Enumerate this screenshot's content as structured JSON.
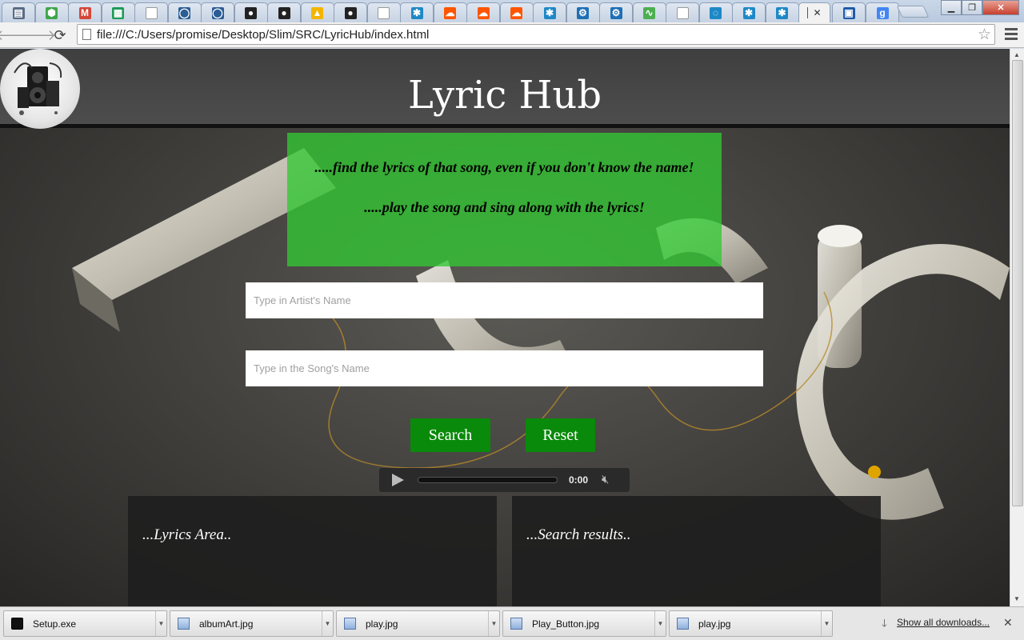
{
  "browser": {
    "tabs": [
      {
        "icon": "doc-icon",
        "color": "#5a6b84"
      },
      {
        "icon": "shield-icon",
        "color": "#3fa64a"
      },
      {
        "icon": "gmail-icon",
        "color": "#d44638"
      },
      {
        "icon": "sheets-icon",
        "color": "#1e9b56"
      },
      {
        "icon": "file-icon",
        "color": "#e0e0e0"
      },
      {
        "icon": "chat-icon",
        "color": "#2b5d95"
      },
      {
        "icon": "chat-icon",
        "color": "#2b5d95"
      },
      {
        "icon": "github-icon",
        "color": "#222222"
      },
      {
        "icon": "github-icon",
        "color": "#222222"
      },
      {
        "icon": "drive-icon",
        "color": "#f4b400"
      },
      {
        "icon": "github-icon",
        "color": "#222222"
      },
      {
        "icon": "file-icon",
        "color": "#e0e0e0"
      },
      {
        "icon": "snowflake-icon",
        "color": "#1e88c7"
      },
      {
        "icon": "soundcloud-icon",
        "color": "#ff5500"
      },
      {
        "icon": "soundcloud-icon",
        "color": "#ff5500"
      },
      {
        "icon": "soundcloud-icon",
        "color": "#ff5500"
      },
      {
        "icon": "snowflake-icon",
        "color": "#1e88c7"
      },
      {
        "icon": "gear-icon",
        "color": "#1e6fb5"
      },
      {
        "icon": "gear-icon",
        "color": "#1e6fb5"
      },
      {
        "icon": "chart-icon",
        "color": "#4caf50"
      },
      {
        "icon": "file-icon",
        "color": "#e0e0e0"
      },
      {
        "icon": "loading-icon",
        "color": "#1e88c7"
      },
      {
        "icon": "snowflake-icon",
        "color": "#1e88c7"
      },
      {
        "icon": "snowflake-icon",
        "color": "#1e88c7"
      }
    ],
    "extra_tabs": [
      {
        "icon": "bracket-icon",
        "color": "#1e5aa8"
      },
      {
        "icon": "google-icon",
        "color": "#4285f4"
      }
    ],
    "address": "file:///C:/Users/promise/Desktop/Slim/SRC/LyricHub/index.html"
  },
  "site": {
    "title": "Lyric Hub",
    "taglines": [
      ".....find the lyrics of that song, even if you don't know the name!",
      ".....play the song and sing along with the lyrics!"
    ],
    "artist_placeholder": "Type in Artist's Name",
    "song_placeholder": "Type in the Song's Name",
    "search_label": "Search",
    "reset_label": "Reset",
    "audio_time": "0:00",
    "lyrics_area_label": "...Lyrics Area..",
    "search_results_label": "...Search results..",
    "accent_green": "#0a8a0a"
  },
  "downloads": {
    "items": [
      {
        "name": "Setup.exe",
        "type": "exe"
      },
      {
        "name": "albumArt.jpg",
        "type": "image"
      },
      {
        "name": "play.jpg",
        "type": "image"
      },
      {
        "name": "Play_Button.jpg",
        "type": "image"
      },
      {
        "name": "play.jpg",
        "type": "image"
      }
    ],
    "show_all": "Show all downloads..."
  }
}
